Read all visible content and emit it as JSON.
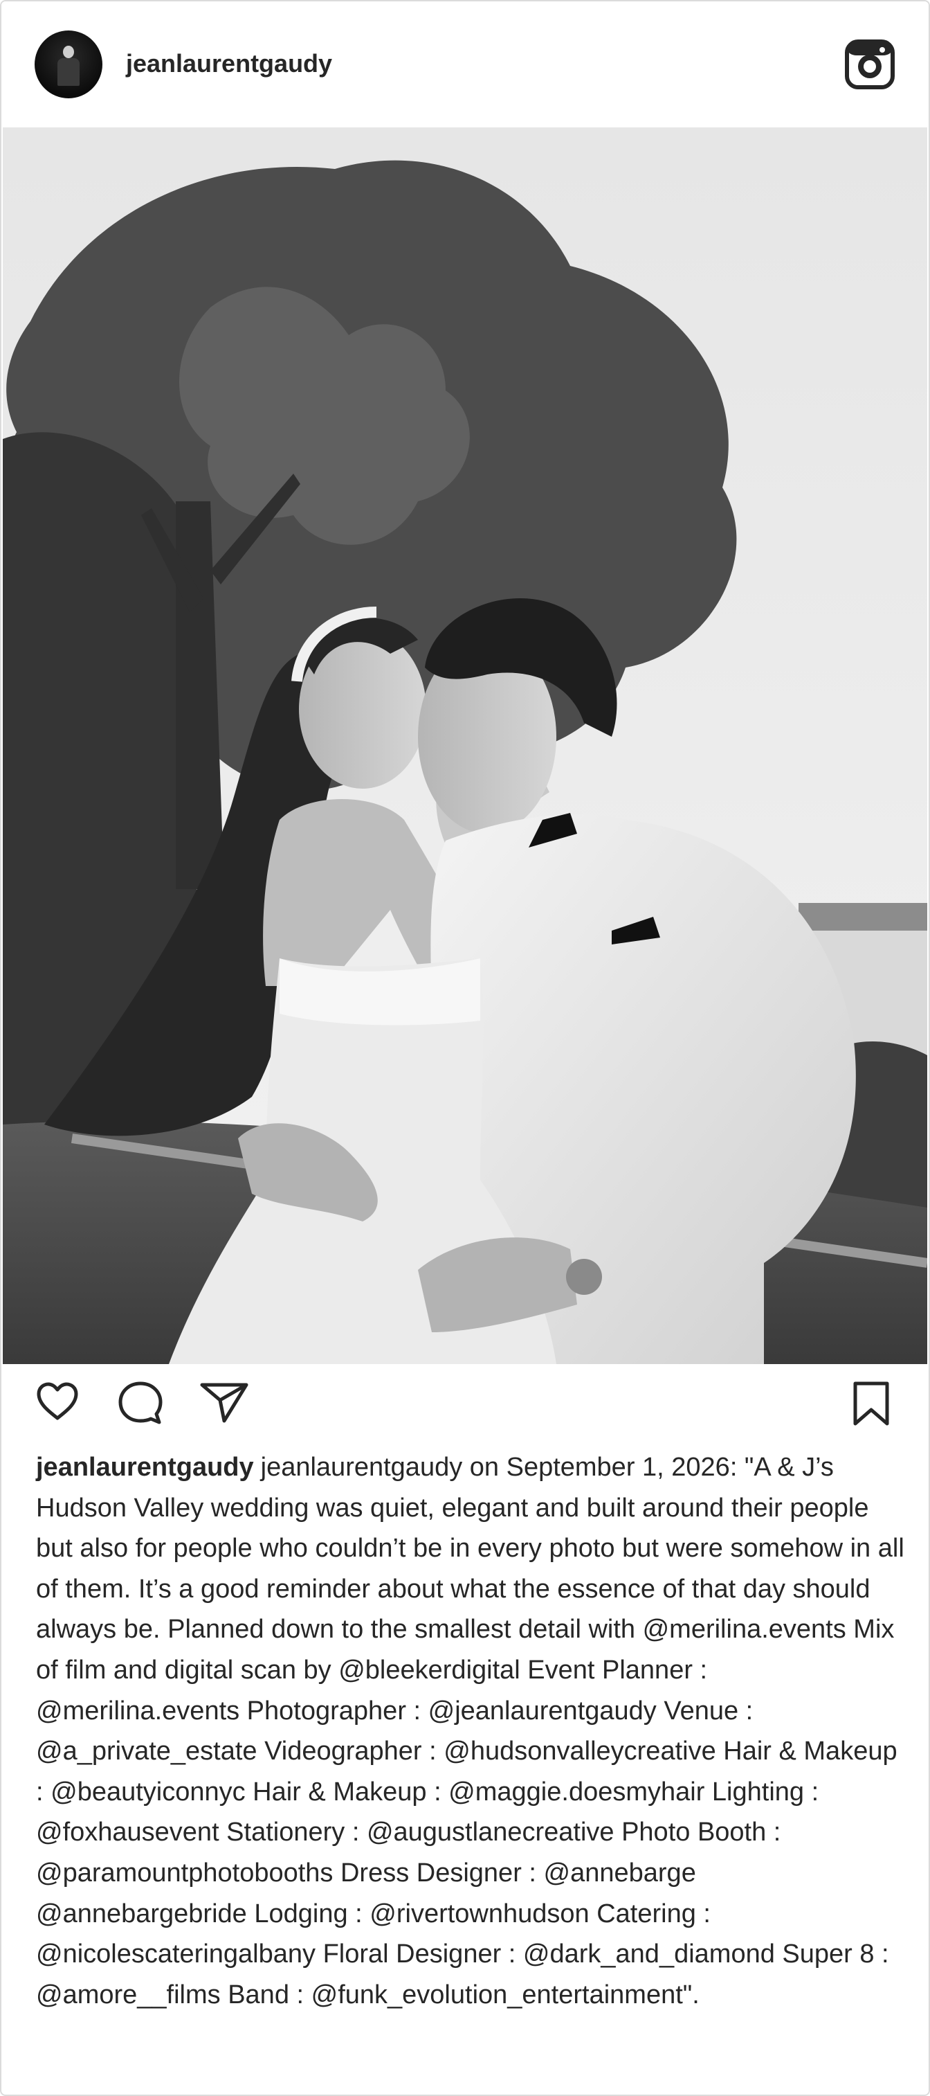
{
  "post": {
    "username": "jeanlaurentgaudy",
    "avatar_icon": "profile-avatar",
    "platform_icon": "instagram-icon",
    "image_alt_subject": "wedding-couple-kissing-photo",
    "actions": {
      "like_icon": "heart-icon",
      "comment_icon": "speech-bubble-icon",
      "share_icon": "paper-plane-icon",
      "save_icon": "bookmark-icon"
    },
    "caption": {
      "username": "jeanlaurentgaudy",
      "text": "jeanlaurentgaudy on September 1, 2026: \"A & J’s Hudson Valley wedding was quiet, elegant and built around their people but also for people who couldn’t be in every photo but were somehow in all of them. It’s a good reminder about what the essence of that day should always be. Planned down to the smallest detail with @merilina.events Mix of film and digital scan by @bleekerdigital Event Planner : @merilina.events Photographer : @jeanlaurentgaudy Venue : @a_private_estate Videographer : @hudsonvalleycreative Hair & Makeup : @beautyiconnyc Hair & Makeup : @maggie.doesmyhair Lighting : @foxhausevent Stationery : @augustlanecreative Photo Booth : @paramountphotobooths Dress Designer : @annebarge @annebargebride Lodging : @rivertownhudson Catering : @nicolescateringalbany Floral Designer : @dark_and_diamond Super 8 : @amore__films Band : @funk_evolution_entertainment\"."
    }
  },
  "colors": {
    "text": "#262626",
    "border": "#dbdbdb",
    "background": "#ffffff"
  }
}
